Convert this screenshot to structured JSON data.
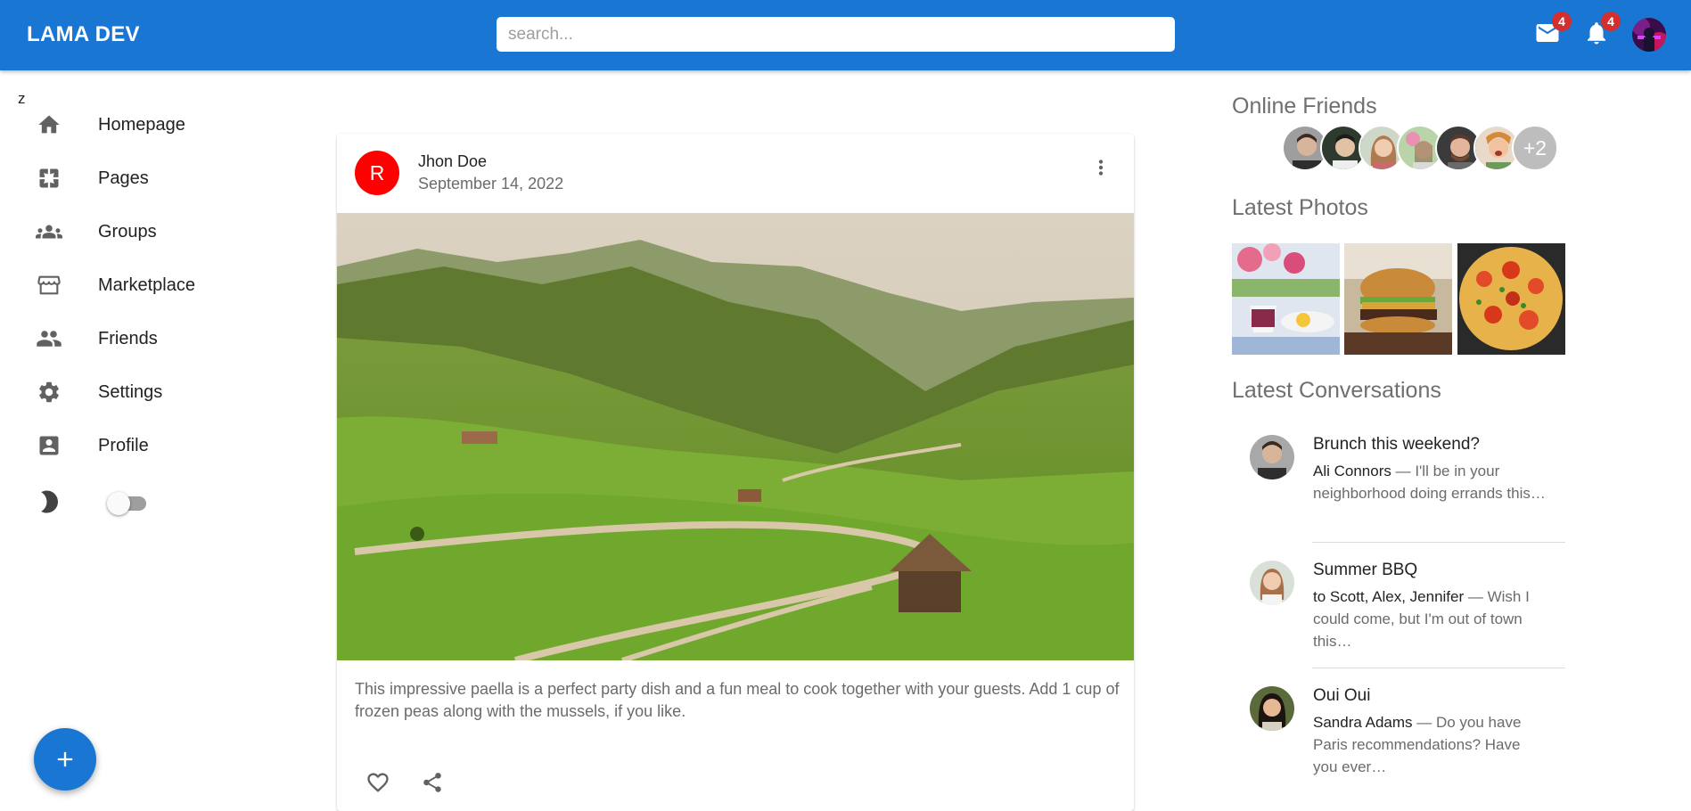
{
  "header": {
    "brand": "LAMA DEV",
    "search_placeholder": "search...",
    "mail_count": "4",
    "notification_count": "4",
    "bar_color": "#1976d2"
  },
  "sidebar": {
    "stray_text": "z",
    "items": [
      {
        "label": "Homepage",
        "icon": "home-icon"
      },
      {
        "label": "Pages",
        "icon": "pages-icon"
      },
      {
        "label": "Groups",
        "icon": "groups-icon"
      },
      {
        "label": "Marketplace",
        "icon": "storefront-icon"
      },
      {
        "label": "Friends",
        "icon": "people-icon"
      },
      {
        "label": "Settings",
        "icon": "settings-icon"
      },
      {
        "label": "Profile",
        "icon": "account-box-icon"
      }
    ],
    "dark_mode_icon": "moon-icon",
    "dark_mode_on": false
  },
  "post": {
    "avatar_letter": "R",
    "avatar_color": "#ff0000",
    "author": "Jhon Doe",
    "date": "September 14, 2022",
    "text": "This impressive paella is a perfect party dish and a fun meal to cook together with your guests. Add 1 cup of frozen peas along with the mussels, if you like."
  },
  "rightbar": {
    "online_title": "Online Friends",
    "online_more": "+2",
    "photos_title": "Latest Photos",
    "conversations_title": "Latest Conversations",
    "conversations": [
      {
        "title": "Brunch this weekend?",
        "who": "Ali Connors",
        "msg": " — I'll be in your neighborhood doing errands this…"
      },
      {
        "title": "Summer BBQ",
        "who": "to Scott, Alex, Jennifer",
        "msg": " — Wish I could come, but I'm out of town this…"
      },
      {
        "title": "Oui Oui",
        "who": "Sandra Adams",
        "msg": " — Do you have Paris recommendations? Have you ever…"
      }
    ]
  }
}
